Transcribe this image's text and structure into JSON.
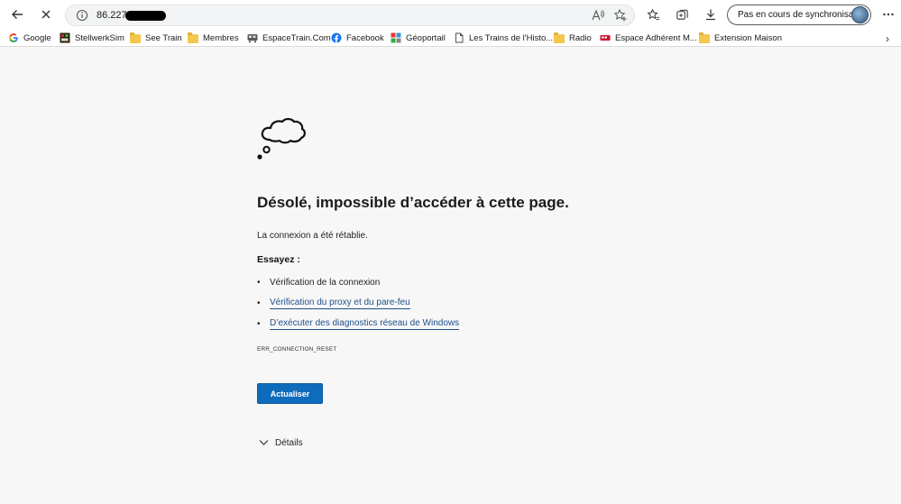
{
  "toolbar": {
    "url": "86.227",
    "sync_label": "Pas en cours de synchronisation"
  },
  "bookmarks": [
    {
      "label": "Google",
      "icon": "google-icon"
    },
    {
      "label": "StellwerkSim",
      "icon": "stellwerksim-icon"
    },
    {
      "label": "See Train",
      "icon": "folder-icon"
    },
    {
      "label": "Membres",
      "icon": "folder-icon"
    },
    {
      "label": "EspaceTrain.Com",
      "icon": "espacetrain-icon"
    },
    {
      "label": "Facebook",
      "icon": "facebook-icon"
    },
    {
      "label": "Géoportail",
      "icon": "geoportail-icon"
    },
    {
      "label": "Les Trains de l'Histo...",
      "icon": "page-icon"
    },
    {
      "label": "Radio",
      "icon": "folder-icon"
    },
    {
      "label": "Espace Adhérent M...",
      "icon": "adherent-icon"
    },
    {
      "label": "Extension Maison",
      "icon": "folder-icon"
    }
  ],
  "error": {
    "title": "Désolé, impossible d’accéder à cette page.",
    "message": "La connexion a été rétablie.",
    "try_heading": "Essayez :",
    "suggestions": [
      {
        "text": "Vérification de la connexion",
        "link": false
      },
      {
        "text": "Vérification du proxy et du pare-feu",
        "link": true
      },
      {
        "text": "D’exécuter des diagnostics réseau de Windows",
        "link": true
      }
    ],
    "code": "ERR_CONNECTION_RESET",
    "button_label": "Actualiser",
    "details_label": "Détails"
  },
  "colors": {
    "accent": "#0f6cbd",
    "link": "#1f4f8a",
    "page_bg": "#f7f7f7"
  }
}
